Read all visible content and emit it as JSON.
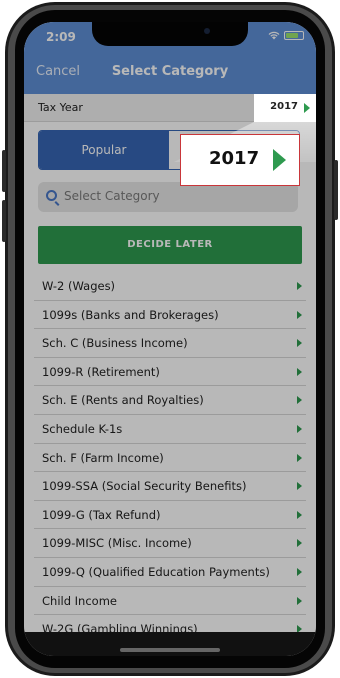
{
  "status_bar": {
    "time": "2:09"
  },
  "nav": {
    "cancel_label": "Cancel",
    "title": "Select Category"
  },
  "tax_year": {
    "label": "Tax Year",
    "value": "2017"
  },
  "segment": {
    "tabs": [
      "Popular",
      ""
    ],
    "active_index": 0
  },
  "search": {
    "placeholder": "Select Category"
  },
  "decide_later": {
    "label": "DECIDE LATER"
  },
  "categories": [
    {
      "label": "W-2 (Wages)"
    },
    {
      "label": "1099s (Banks and Brokerages)"
    },
    {
      "label": "Sch. C (Business Income)"
    },
    {
      "label": "1099-R (Retirement)"
    },
    {
      "label": "Sch. E (Rents and Royalties)"
    },
    {
      "label": "Schedule K-1s"
    },
    {
      "label": "Sch. F (Farm Income)"
    },
    {
      "label": "1099-SSA (Social Security Benefits)"
    },
    {
      "label": "1099-G (Tax Refund)"
    },
    {
      "label": "1099-MISC (Misc. Income)"
    },
    {
      "label": "1099-Q (Qualified Education Payments)"
    },
    {
      "label": "Child Income"
    },
    {
      "label": "W-2G (Gambling Winnings)"
    }
  ],
  "callout": {
    "value": "2017"
  },
  "colors": {
    "header_blue": "#5f8fd6",
    "segment_blue": "#3766b5",
    "accent_green": "#2e9a4f",
    "callout_border": "#c9363a"
  }
}
